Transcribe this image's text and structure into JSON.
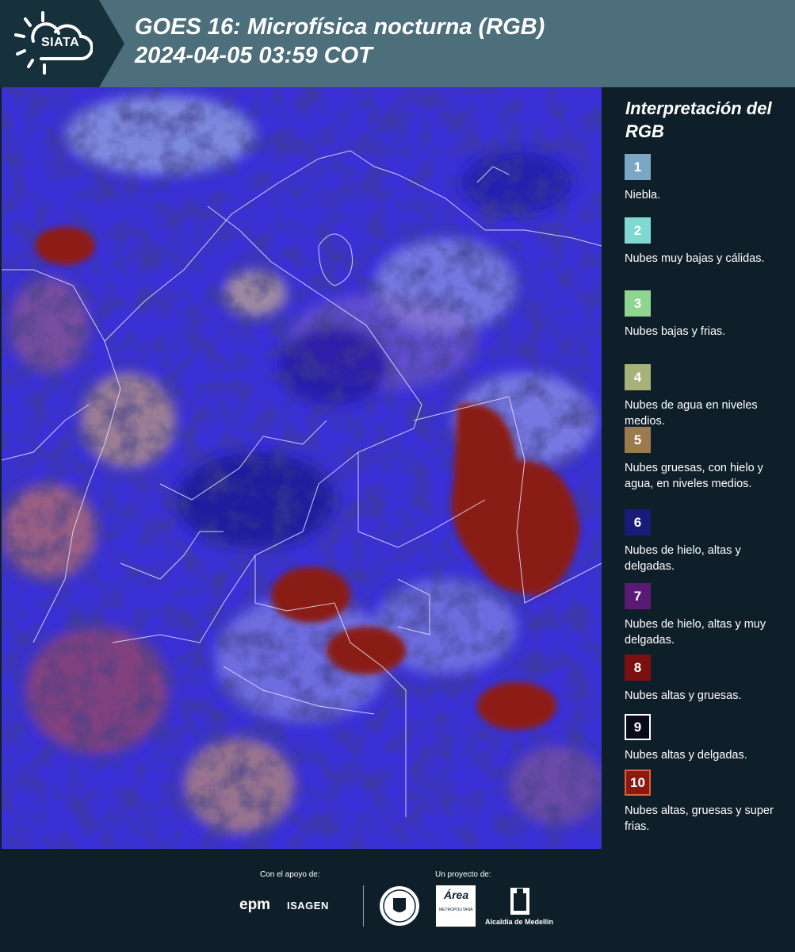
{
  "header": {
    "logo_text": "SIATA",
    "title_line1": "GOES 16: Microfísica nocturna (RGB)",
    "title_line2": "2024-04-05 03:59 COT"
  },
  "legend": {
    "title": "Interpretación del RGB",
    "items": [
      {
        "num": "1",
        "label": "Niebla.",
        "color": "#7ba6c4"
      },
      {
        "num": "2",
        "label": "Nubes muy bajas y cálidas.",
        "color": "#7fd9d2"
      },
      {
        "num": "3",
        "label": "Nubes bajas y frias.",
        "color": "#8fd48f"
      },
      {
        "num": "4",
        "label": "Nubes de agua en niveles medios.",
        "color": "#a6b27a"
      },
      {
        "num": "5",
        "label": "Nubes gruesas, con hielo y agua, en niveles medios.",
        "color": "#9b7a4d"
      },
      {
        "num": "6",
        "label": "Nubes de hielo, altas y delgadas.",
        "color": "#1a1a78"
      },
      {
        "num": "7",
        "label": "Nubes de hielo, altas y muy delgadas.",
        "color": "#5a1a72"
      },
      {
        "num": "8",
        "label": "Nubes altas y gruesas.",
        "color": "#7a1010"
      },
      {
        "num": "9",
        "label": "Nubes altas y delgadas.",
        "color": "#0a0a1a"
      },
      {
        "num": "10",
        "label": "Nubes altas, gruesas y super frias.",
        "color": "#8a1a10"
      }
    ]
  },
  "footer": {
    "support_label": "Con el apoyo de:",
    "project_label": "Un proyecto de:",
    "epm": "epm",
    "isagen": "ISAGEN",
    "area_name": "METROPOLITANA",
    "alcaldia": "Alcaldía de Medellín"
  }
}
